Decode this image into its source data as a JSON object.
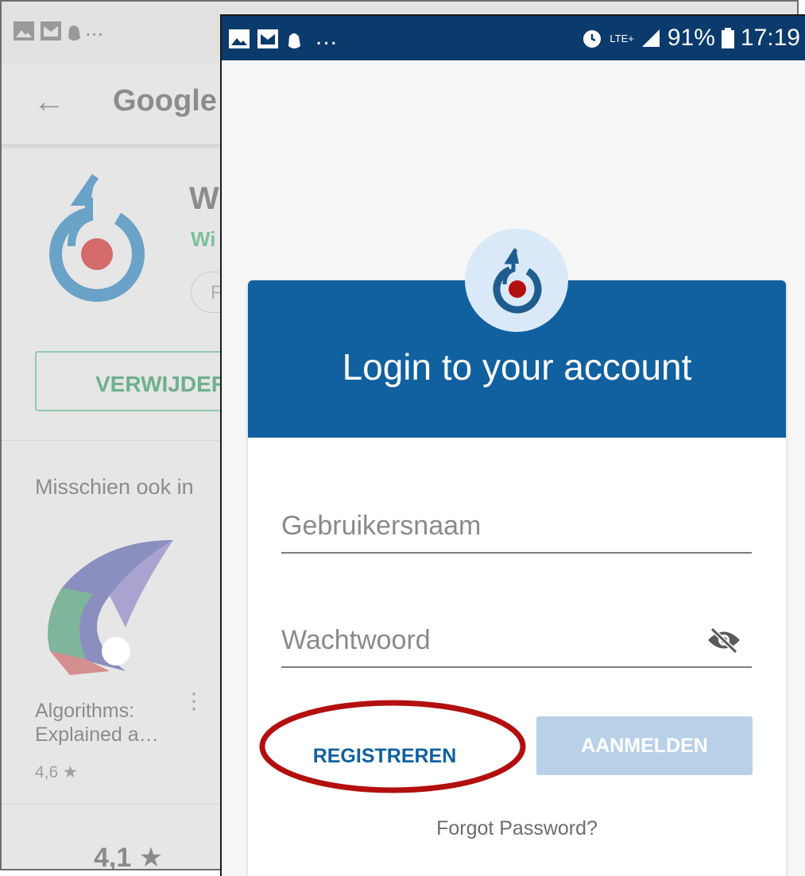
{
  "background": {
    "status": {
      "icons": [
        "gallery-icon",
        "mail-icon",
        "hand-icon"
      ],
      "overflow": "..."
    },
    "appbar": {
      "title": "Google"
    },
    "app": {
      "name_partial": "W",
      "developer_partial": "Wi",
      "chip_partial": "F",
      "uninstall_label_partial": "VERWIJDER"
    },
    "section_title_partial": "Misschien ook in",
    "suggestion": {
      "name_line1": "Algorithms:",
      "name_line2": "Explained a…",
      "rating": "4,6 ★"
    },
    "overall_rating": "4,1 ★"
  },
  "foreground": {
    "status": {
      "left_icons": [
        "gallery-icon",
        "mail-icon",
        "hand-icon"
      ],
      "overflow": "...",
      "network": "LTE+",
      "battery": "91%",
      "time": "17:19"
    },
    "card": {
      "title": "Login to your account",
      "username_placeholder": "Gebruikersnaam",
      "password_placeholder": "Wachtwoord",
      "register_label": "REGISTREREN",
      "login_label": "AANMELDEN",
      "forgot_label": "Forgot Password?"
    }
  },
  "colors": {
    "header_blue": "#1160a0",
    "status_blue": "#0b3a6c",
    "highlight_ring": "#b30f0f",
    "login_disabled": "#b9d1e8"
  }
}
